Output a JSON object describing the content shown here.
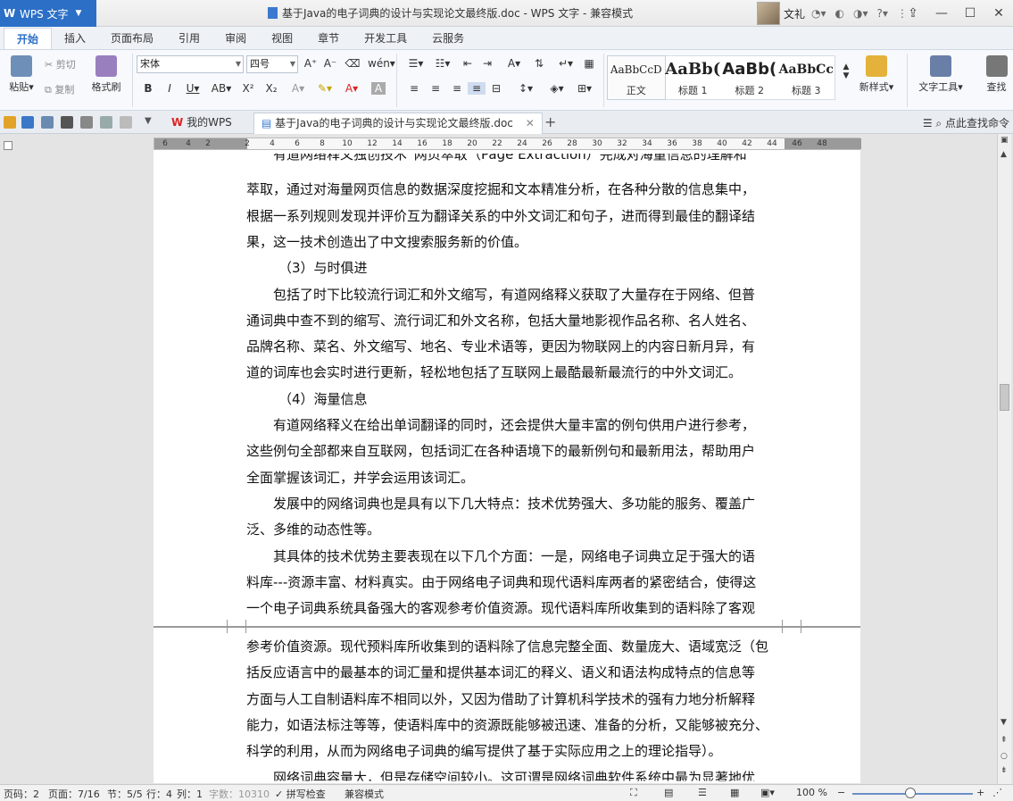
{
  "app": {
    "menu_label": "WPS 文字"
  },
  "title": "基于Java的电子词典的设计与实现论文最终版.doc - WPS 文字 - 兼容模式",
  "user": {
    "name": "文礼"
  },
  "tabs": [
    "开始",
    "插入",
    "页面布局",
    "引用",
    "审阅",
    "视图",
    "章节",
    "开发工具",
    "云服务"
  ],
  "ribbon": {
    "paste": "粘贴",
    "cut": "剪切",
    "copy": "复制",
    "format_painter": "格式刷",
    "font_name": "宋体",
    "font_size": "四号",
    "styles": [
      {
        "preview": "AaBbCcD",
        "label": "正文"
      },
      {
        "preview": "AaBb(",
        "label": "标题 1"
      },
      {
        "preview": "AaBb(",
        "label": "标题 2"
      },
      {
        "preview": "AaBbCc",
        "label": "标题 3"
      }
    ],
    "new_style": "新样式",
    "text_tools": "文字工具",
    "find": "查找"
  },
  "doc_tabs": {
    "home": "我的WPS",
    "current": "基于Java的电子词典的设计与实现论文最终版.doc"
  },
  "find_command": "点此查找命令",
  "ruler_numbers": [
    "6",
    "4",
    "2",
    "2",
    "4",
    "6",
    "8",
    "10",
    "12",
    "14",
    "16",
    "18",
    "20",
    "22",
    "24",
    "26",
    "28",
    "30",
    "32",
    "34",
    "36",
    "38",
    "40",
    "42",
    "44",
    "46",
    "48"
  ],
  "document": {
    "page1_lines": [
      "有道网络释义独创技术“网页萃取”（Page Extraction）完成对海量信息的理解和",
      "萃取，通过对海量网页信息的数据深度挖掘和文本精准分析，在各种分散的信息集中，",
      "根据一系列规则发现并评价互为翻译关系的中外文词汇和句子，进而得到最佳的翻译结",
      "果，这一技术创造出了中文搜索服务新的价值。",
      "（3）与时俱进",
      "包括了时下比较流行词汇和外文缩写，有道网络释义获取了大量存在于网络、但普",
      "通词典中查不到的缩写、流行词汇和外文名称，包括大量地影视作品名称、名人姓名、",
      "品牌名称、菜名、外文缩写、地名、专业术语等，更因为物联网上的内容日新月异，有",
      "道的词库也会实时进行更新，轻松地包括了互联网上最酷最新最流行的中外文词汇。",
      "（4）海量信息",
      "有道网络释义在给出单词翻译的同时，还会提供大量丰富的例句供用户进行参考，",
      "这些例句全部都来自互联网，包括词汇在各种语境下的最新例句和最新用法，帮助用户",
      "全面掌握该词汇，并学会运用该词汇。",
      "发展中的网络词典也是具有以下几大特点：技术优势强大、多功能的服务、覆盖广",
      "泛、多维的动态性等。",
      "其具体的技术优势主要表现在以下几个方面：一是，网络电子词典立足于强大的语",
      "料库---资源丰富、材料真实。由于网络电子词典和现代语料库两者的紧密结合，使得这",
      "一个电子词典系统具备强大的客观参考价值资源。现代语料库所收集到的语料除了客观"
    ],
    "page2_lines": [
      "参考价值资源。现代预料库所收集到的语料除了信息完整全面、数量庞大、语域宽泛（包",
      "括反应语言中的最基本的词汇量和提供基本词汇的释义、语义和语法构成特点的信息等",
      "方面与人工自制语料库不相同以外，又因为借助了计算机科学技术的强有力地分析解释",
      "能力，如语法标注等等，使语料库中的资源既能够被迅速、准备的分析，又能够被充分、",
      "科学的利用，从而为网络电子词典的编写提供了基于实际应用之上的理论指导）。",
      "网络词典容量大，但是存储空间较小。这可谓是网络词典软件系统中最为显著地优"
    ]
  },
  "status": {
    "page_num": "页码：2",
    "pages": "页面：7/16",
    "section": "节：5/5",
    "row": "行：4",
    "col": "列：1",
    "word_count": "字数：10310",
    "spell_check": "拼写检查",
    "compat": "兼容模式",
    "zoom": "100 %"
  },
  "colors": {
    "accent": "#2b6fc6",
    "ribbon_bg": "#f7f9fc"
  }
}
